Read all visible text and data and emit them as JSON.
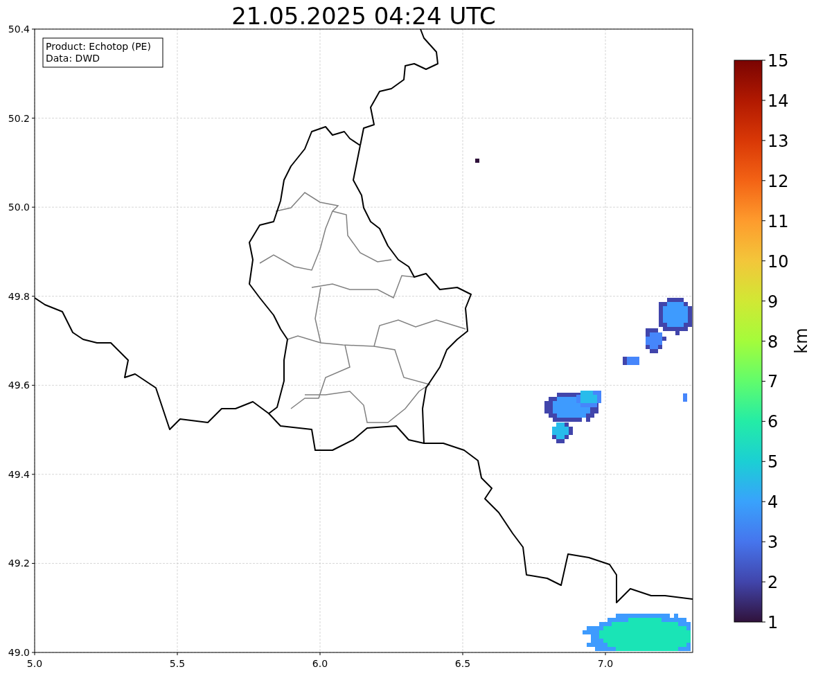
{
  "title": "21.05.2025 04:24 UTC",
  "legend": [
    "Product: Echotop (PE)",
    "Data: DWD"
  ],
  "x_ticks": [
    "5.0",
    "5.5",
    "6.0",
    "6.5",
    "7.0"
  ],
  "y_ticks": [
    "50.4",
    "50.2",
    "50.0",
    "49.8",
    "49.6",
    "49.4",
    "49.2",
    "49.0"
  ],
  "colorbar": {
    "label": "km",
    "ticks": [
      "15",
      "14",
      "13",
      "12",
      "11",
      "10",
      "9",
      "8",
      "7",
      "6",
      "5",
      "4",
      "3",
      "2",
      "1"
    ]
  }
}
